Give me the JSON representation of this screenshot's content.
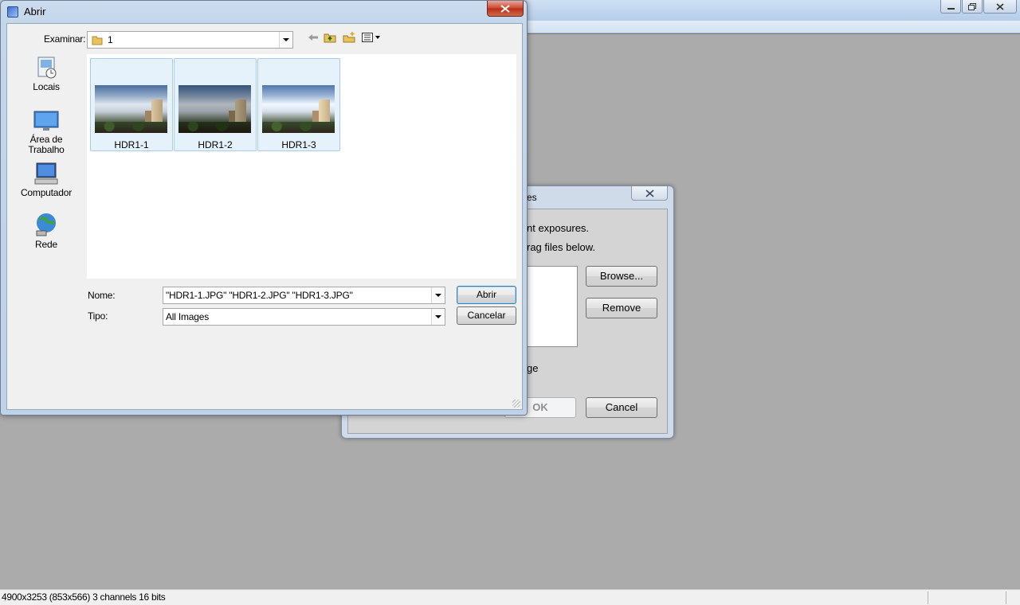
{
  "app": {
    "status_text": "4900x3253 (853x566) 3 channels 16 bits"
  },
  "background_dialog": {
    "title_fragment": "es",
    "line1": "nt exposures.",
    "line2": "rag files below.",
    "browse_label": "Browse...",
    "remove_label": "Remove",
    "checkbox_fragment": "ge",
    "ok_label": "OK",
    "cancel_label": "Cancel"
  },
  "open_dialog": {
    "title": "Abrir",
    "look_in_label": "Examinar:",
    "look_in_value": "1",
    "places": [
      {
        "label": "Locais",
        "icon": "recent-places-icon"
      },
      {
        "label": "Área de Trabalho",
        "icon": "desktop-icon"
      },
      {
        "label": "Computador",
        "icon": "computer-icon"
      },
      {
        "label": "Rede",
        "icon": "network-icon"
      }
    ],
    "files": [
      {
        "name": "HDR1-1"
      },
      {
        "name": "HDR1-2"
      },
      {
        "name": "HDR1-3"
      }
    ],
    "name_label": "Nome:",
    "name_value": "\"HDR1-1.JPG\" \"HDR1-2.JPG\" \"HDR1-3.JPG\"",
    "type_label": "Tipo:",
    "type_value": "All Images",
    "open_label": "Abrir",
    "cancel_label": "Cancelar"
  }
}
